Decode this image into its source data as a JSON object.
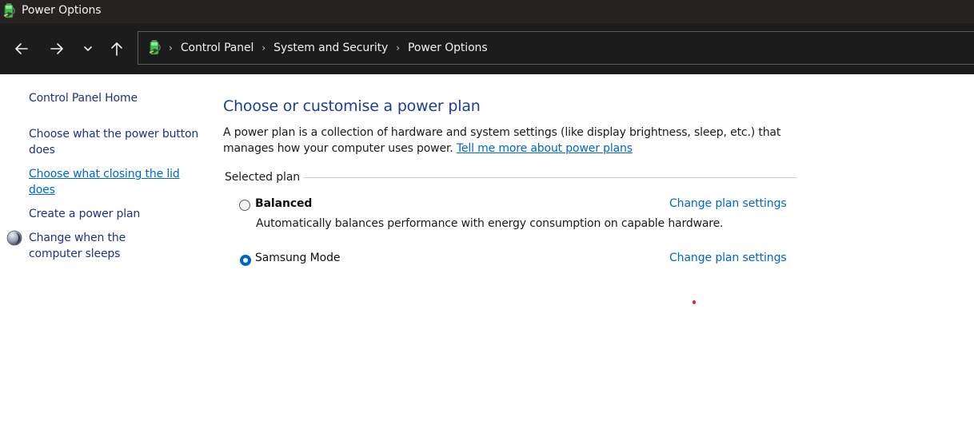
{
  "window": {
    "title": "Power Options",
    "icon": "battery-power-icon"
  },
  "toolbar": {
    "back_icon": "arrow-left-icon",
    "forward_icon": "arrow-right-icon",
    "recent_icon": "chevron-down-icon",
    "up_icon": "arrow-up-icon",
    "breadcrumb": {
      "icon": "battery-power-icon",
      "separator": "›",
      "items": [
        "Control Panel",
        "System and Security",
        "Power Options"
      ]
    }
  },
  "sidebar": {
    "items": [
      {
        "label": "Control Panel Home"
      },
      {
        "label": "Choose what the power button does"
      },
      {
        "label": "Choose what closing the lid does",
        "state": "hover"
      },
      {
        "label": "Create a power plan"
      },
      {
        "label": "Change when the computer sleeps",
        "icon": "moon-sleep-icon"
      }
    ]
  },
  "main": {
    "title": "Choose or customise a power plan",
    "description": "A power plan is a collection of hardware and system settings (like display brightness, sleep, etc.) that manages how your computer uses power.",
    "learn_more_link": "Tell me more about power plans",
    "group_label": "Selected plan",
    "plans": [
      {
        "name": "Balanced",
        "selected": false,
        "description": "Automatically balances performance with energy consumption on capable hardware.",
        "link": "Change plan settings"
      },
      {
        "name": "Samsung Mode",
        "selected": true,
        "description": "",
        "link": "Change plan settings"
      }
    ]
  },
  "colors": {
    "titlebar_bg": "#272222",
    "toolbar_bg": "#1c1c1c",
    "heading_blue": "#1e3c96",
    "link_blue": "#0066cc",
    "nav_link": "#1e3287",
    "radio_selected": "#0067c0",
    "marker_red": "#e32020"
  }
}
